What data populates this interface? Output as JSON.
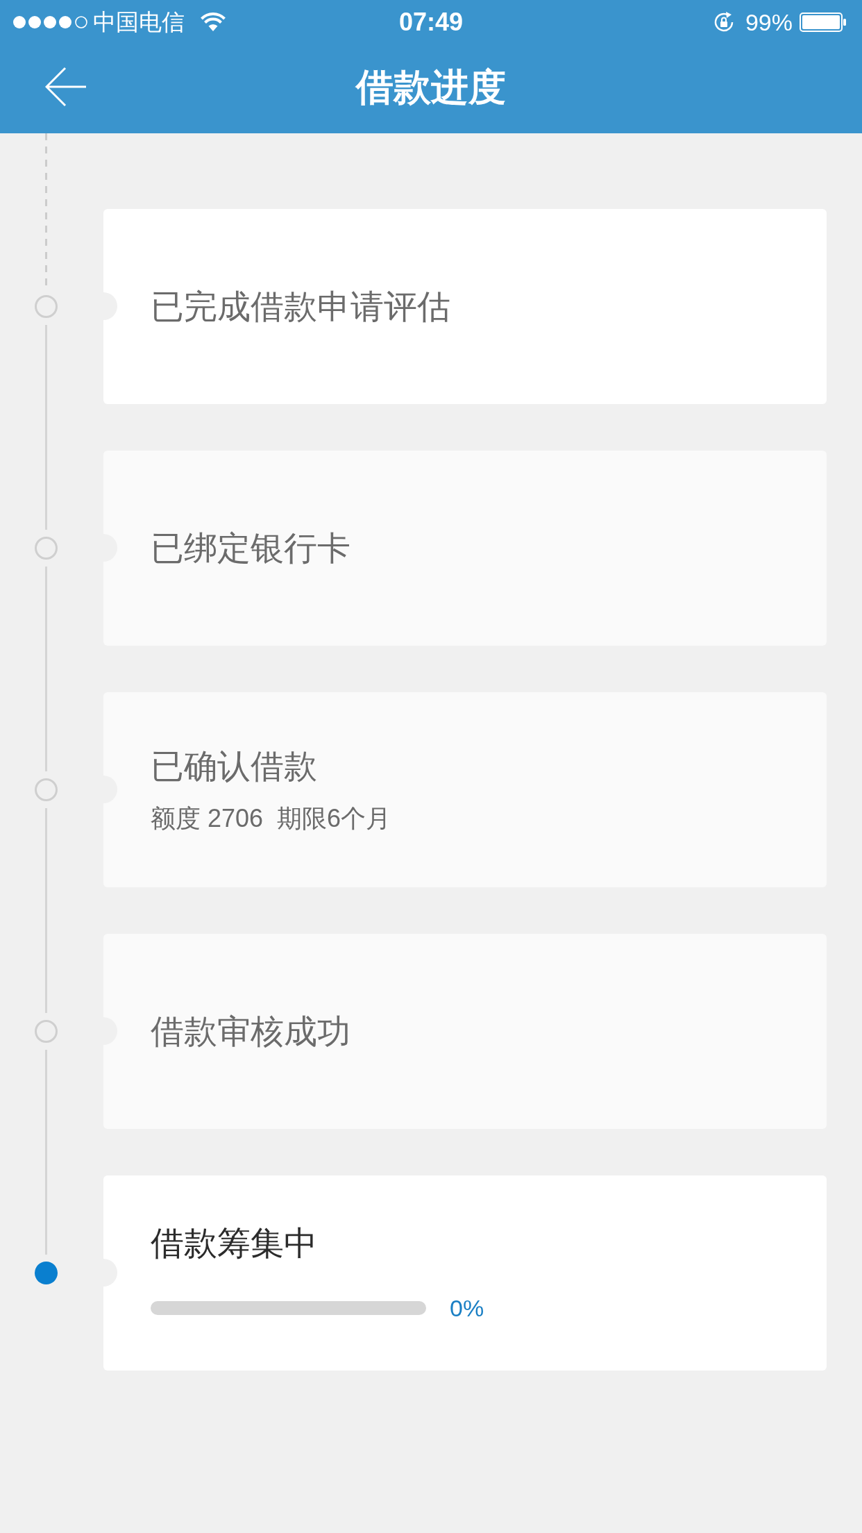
{
  "status_bar": {
    "carrier": "中国电信",
    "time": "07:49",
    "battery": "99%"
  },
  "header": {
    "title": "借款进度"
  },
  "steps": [
    {
      "title": "已完成借款申请评估",
      "active": false,
      "shaded": false
    },
    {
      "title": "已绑定银行卡",
      "active": false,
      "shaded": true
    },
    {
      "title": "已确认借款",
      "detail": "额度 2706  期限6个月",
      "active": false,
      "shaded": true
    },
    {
      "title": "借款审核成功",
      "active": false,
      "shaded": true
    },
    {
      "title": "借款筹集中",
      "active": true,
      "shaded": false,
      "progress": {
        "level": 0,
        "reading": "0%"
      }
    }
  ]
}
